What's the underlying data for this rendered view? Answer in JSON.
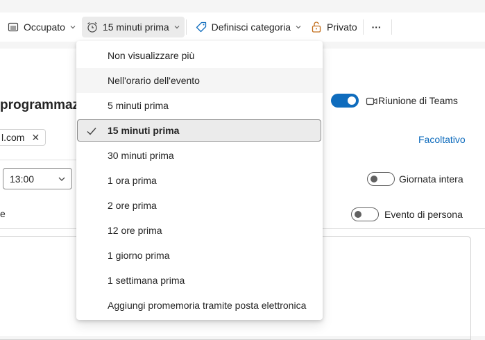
{
  "toolbar": {
    "show_as": {
      "label": "Occupato",
      "icon": "calendar-busy-icon"
    },
    "reminder": {
      "label": "15 minuti prima",
      "icon": "alarm-clock-icon"
    },
    "category": {
      "label": "Definisci categoria",
      "icon": "tag-icon"
    },
    "private": {
      "label": "Privato",
      "icon": "lock-icon"
    },
    "more": {
      "label": "···",
      "icon": "more-icon"
    }
  },
  "form": {
    "title_partial": "programmaz",
    "attendee_partial": "l.com",
    "attendee_remove_symbol": "✕",
    "time_value": "13:00",
    "partial_text": "e",
    "teams": {
      "label": "Riunione di Teams",
      "on": true
    },
    "optional_link": "Facoltativo",
    "all_day": {
      "label": "Giornata intera",
      "on": false
    },
    "in_person": {
      "label": "Evento di persona",
      "on": false
    }
  },
  "reminder_menu": {
    "selected_index": 3,
    "hover_index": 1,
    "items": [
      "Non visualizzare più",
      "Nell'orario dell'evento",
      "5 minuti prima",
      "15 minuti prima",
      "30 minuti prima",
      "1 ora prima",
      "2 ore prima",
      "12 ore prima",
      "1 giorno prima",
      "1 settimana prima",
      "Aggiungi promemoria tramite posta elettronica"
    ]
  },
  "colors": {
    "accent": "#0f6cbd",
    "text": "#242424",
    "menu_selected_bg": "#ebebeb"
  }
}
